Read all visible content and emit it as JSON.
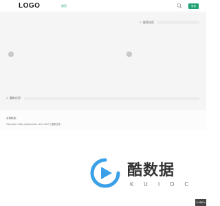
{
  "header": {
    "logo": "LOGO",
    "nav_home": "首页",
    "search_icon": "search-icon",
    "login_label": "登录"
  },
  "sections": {
    "recommend": {
      "mark": "⊞",
      "title": "推荐应用"
    },
    "latest": {
      "mark": "⊞",
      "title": "最新应用"
    }
  },
  "carousel": {
    "prev_icon": "chevron-left-icon",
    "prev_glyph": "‹",
    "next_icon": "chevron-right-icon",
    "next_glyph": "›"
  },
  "footer": {
    "friendly_links": "友情链接:",
    "copyright": "Copyright https://www.kuidc.com/ 2025 | 酷数优惠"
  },
  "watermark": {
    "cn": "酷数据",
    "en": "KUIDC"
  },
  "badge": {
    "text": "0.0861s"
  },
  "colors": {
    "accent": "#1fa171",
    "nav_active": "#16a267",
    "canvas_bg": "#f5f5f5",
    "watermark_blue": "#3aa0e8"
  }
}
